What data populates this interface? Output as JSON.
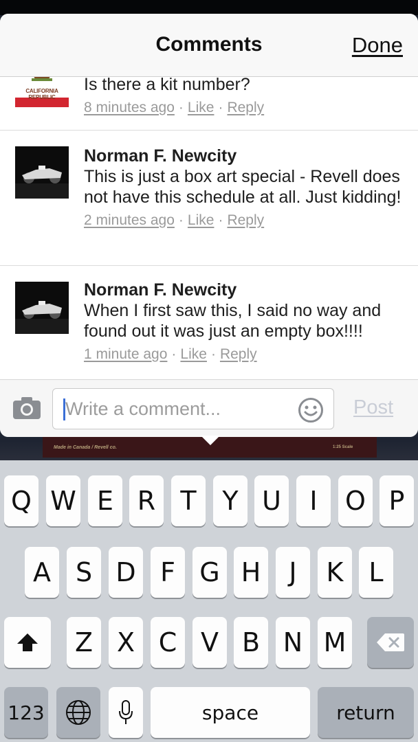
{
  "header": {
    "title": "Comments",
    "done_label": "Done"
  },
  "comments": [
    {
      "author": "",
      "avatar": "california-flag",
      "avatar_caption": "CALIFORNIA REPUBLIC",
      "text": "Is there a kit number?",
      "time": "8 minutes ago",
      "like_label": "Like",
      "reply_label": "Reply"
    },
    {
      "author": "Norman F. Newcity",
      "avatar": "race-car-photo",
      "text": "This is just a box art special - Revell does not have this schedule at all. Just kidding!",
      "time": "2 minutes ago",
      "like_label": "Like",
      "reply_label": "Reply"
    },
    {
      "author": "Norman F. Newcity",
      "avatar": "race-car-photo",
      "text": "When I first saw this, I said no way and found out it was just an empty box!!!!",
      "time": "1 minute ago",
      "like_label": "Like",
      "reply_label": "Reply"
    }
  ],
  "meta_separator": "·",
  "composer": {
    "placeholder": "Write a comment...",
    "post_label": "Post",
    "camera_icon": "camera-icon",
    "emoji_icon": "smiley-icon"
  },
  "background": {
    "left_text": "Made in Canada / Revell co.",
    "right_text": "1:25 Scale"
  },
  "keyboard": {
    "row1": [
      "Q",
      "W",
      "E",
      "R",
      "T",
      "Y",
      "U",
      "I",
      "O",
      "P"
    ],
    "row2": [
      "A",
      "S",
      "D",
      "F",
      "G",
      "H",
      "J",
      "K",
      "L"
    ],
    "row3": [
      "Z",
      "X",
      "C",
      "V",
      "B",
      "N",
      "M"
    ],
    "numbers_label": "123",
    "space_label": "space",
    "return_label": "return",
    "shift_icon": "shift-icon",
    "delete_icon": "delete-icon",
    "globe_icon": "globe-icon",
    "mic_icon": "microphone-icon"
  },
  "colors": {
    "caret": "#3b6fd6",
    "post_disabled": "#c9cdd6",
    "meta_text": "#9a9a9a"
  }
}
